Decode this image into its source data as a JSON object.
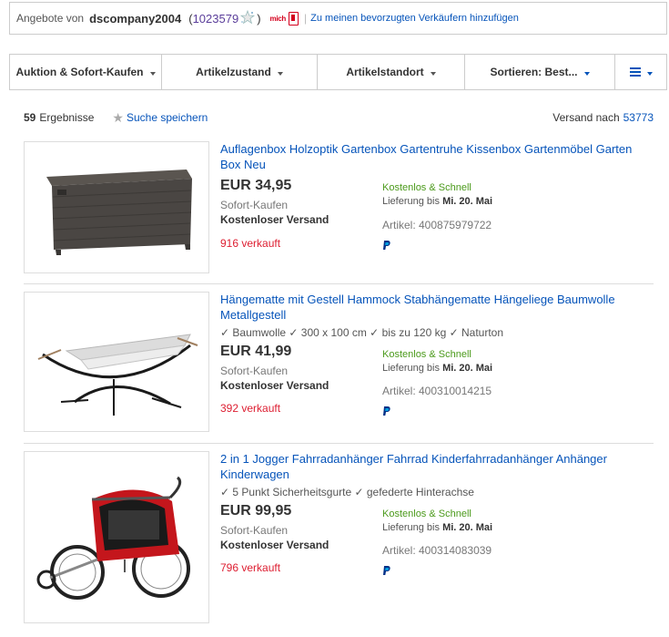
{
  "seller": {
    "label": "Angebote von",
    "name": "dscompany2004",
    "paren_open": "(",
    "score": "1023579",
    "paren_close": ")",
    "me_label": "mich",
    "separator": "|",
    "favorite_link": "Zu meinen bevorzugten Verkäufern hinzufügen"
  },
  "filters": [
    {
      "label": "Auktion & Sofort-Kaufen"
    },
    {
      "label": "Artikelzustand"
    },
    {
      "label": "Artikelstandort"
    },
    {
      "label": "Sortieren: Best..."
    }
  ],
  "results": {
    "count": "59",
    "count_label": "Ergebnisse",
    "save_search": "Suche speichern",
    "ship_to_label": "Versand nach",
    "ship_to_zip": "53773"
  },
  "items": [
    {
      "title": "Auflagenbox Holzoptik Gartenbox Gartentruhe Kissenbox Gartenmöbel Garten Box Neu",
      "attrs": "",
      "price": "EUR 34,95",
      "format": "Sofort-Kaufen",
      "shipping": "Kostenloser Versand",
      "sold": "916 verkauft",
      "fast": "Kostenlos & Schnell",
      "delivery_prefix": "Lieferung bis",
      "delivery_date": "Mi. 20. Mai",
      "article": "Artikel: 400875979722"
    },
    {
      "title": "Hängematte mit Gestell Hammock Stabhängematte Hängeliege Baumwolle Metallgestell",
      "attrs": "✓ Baumwolle ✓ 300 x 100 cm ✓ bis zu 120 kg ✓ Naturton",
      "price": "EUR 41,99",
      "format": "Sofort-Kaufen",
      "shipping": "Kostenloser Versand",
      "sold": "392 verkauft",
      "fast": "Kostenlos & Schnell",
      "delivery_prefix": "Lieferung bis",
      "delivery_date": "Mi. 20. Mai",
      "article": "Artikel: 400310014215"
    },
    {
      "title": "2 in 1 Jogger Fahrradanhänger Fahrrad Kinderfahrradanhänger Anhänger Kinderwagen",
      "attrs": "✓ 5 Punkt Sicherheitsgurte ✓ gefederte Hinterachse",
      "price": "EUR 99,95",
      "format": "Sofort-Kaufen",
      "shipping": "Kostenloser Versand",
      "sold": "796 verkauft",
      "fast": "Kostenlos & Schnell",
      "delivery_prefix": "Lieferung bis",
      "delivery_date": "Mi. 20. Mai",
      "article": "Artikel: 400314083039"
    }
  ],
  "colors": {
    "link": "#0654ba",
    "sold": "#dd1e31",
    "fast": "#4b9a1b",
    "score": "#5a3d9a"
  }
}
